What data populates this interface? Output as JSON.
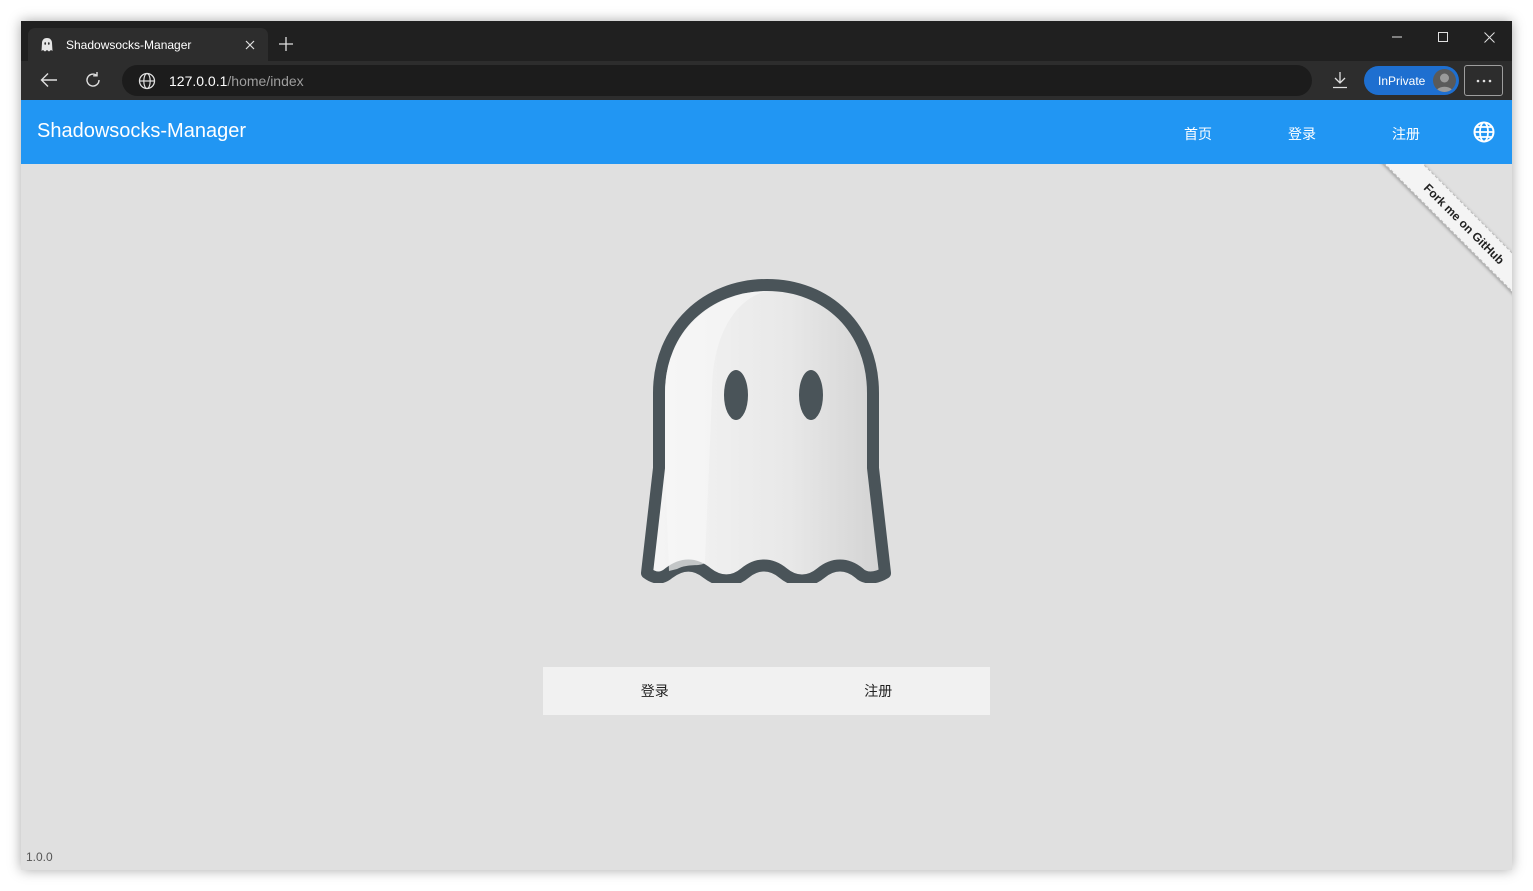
{
  "browser": {
    "tab_title": "Shadowsocks-Manager",
    "address_host": "127.0.0.1",
    "address_path": "/home/index",
    "inprivate_label": "InPrivate"
  },
  "app": {
    "title": "Shadowsocks-Manager",
    "nav": [
      "首页",
      "登录",
      "注册"
    ],
    "ribbon_text": "Fork me on GitHub",
    "buttons": {
      "login": "登录",
      "signup": "注册"
    },
    "version": "1.0.0"
  },
  "colors": {
    "header": "#2196f3",
    "page_bg": "#e0e0e0",
    "ghost_outline": "#4a5459"
  }
}
